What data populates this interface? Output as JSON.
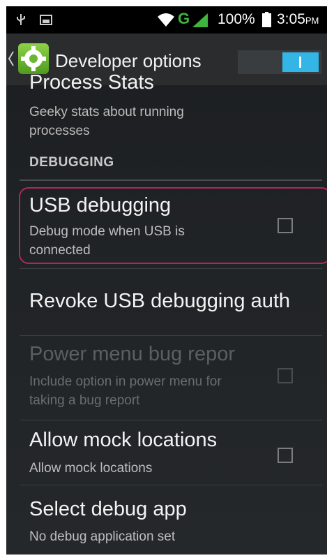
{
  "status_bar": {
    "network_type": "G",
    "battery": "100%",
    "time": "3:05",
    "ampm": "PM"
  },
  "action_bar": {
    "title": "Developer options",
    "master_switch_on": true,
    "accent_color": "#33b5e5"
  },
  "settings": {
    "process_stats": {
      "title": "Process Stats",
      "summary": "Geeky stats about running processes"
    },
    "section_header": "DEBUGGING",
    "usb_debugging": {
      "title": "USB debugging",
      "summary": "Debug mode when USB is connected",
      "checked": false
    },
    "revoke": {
      "title": "Revoke USB debugging auth"
    },
    "power_menu": {
      "title": "Power menu bug repor",
      "summary": "Include option in power menu for taking a bug report",
      "enabled": false,
      "checked": false
    },
    "mock_locations": {
      "title": "Allow mock locations",
      "summary": "Allow mock locations",
      "checked": false
    },
    "debug_app": {
      "title": "Select debug app",
      "summary": "No debug application set"
    }
  },
  "highlight_color": "#b0275b"
}
